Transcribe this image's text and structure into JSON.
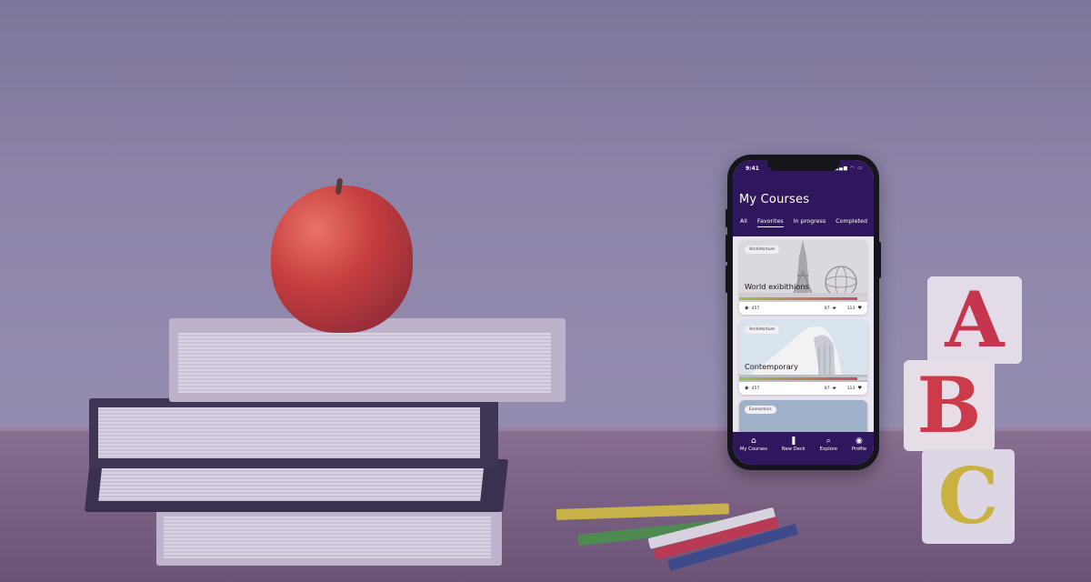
{
  "status_bar": {
    "time": "9:41",
    "icons": "▂▄▆ ◠ ▭"
  },
  "header": {
    "title": "My Courses"
  },
  "tabs": [
    {
      "label": "All",
      "active": false
    },
    {
      "label": "Favorites",
      "active": true
    },
    {
      "label": "In progress",
      "active": false
    },
    {
      "label": "Completed",
      "active": false
    }
  ],
  "courses": [
    {
      "tag": "Architecture",
      "title": "World exibithions",
      "views": "457",
      "comments": "87",
      "likes": "113",
      "progress": 0.92
    },
    {
      "tag": "Architecture",
      "title": "Contemporary",
      "views": "457",
      "comments": "87",
      "likes": "113",
      "progress": 0.92
    },
    {
      "tag": "Economics",
      "title": "",
      "views": "",
      "comments": "",
      "likes": ""
    }
  ],
  "bottom_nav": [
    {
      "label": "My Courses",
      "icon": "home-icon",
      "glyph": "⌂"
    },
    {
      "label": "New Deck",
      "icon": "bookmark-icon",
      "glyph": "❚"
    },
    {
      "label": "Explore",
      "icon": "search-icon",
      "glyph": "⌕"
    },
    {
      "label": "Profile",
      "icon": "profile-icon",
      "glyph": "◉"
    }
  ],
  "blocks": [
    "A",
    "B",
    "C"
  ],
  "colors": {
    "brand": "#2e175c",
    "overlay": "#7f739c",
    "progress_start": "#9bc24a",
    "progress_end": "#c94a6a"
  }
}
